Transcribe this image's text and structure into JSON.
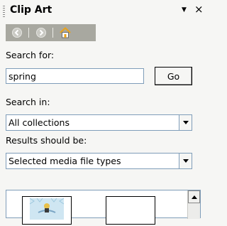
{
  "panel": {
    "title": "Clip Art"
  },
  "nav": {
    "icons": [
      "back-icon",
      "forward-icon",
      "home-icon"
    ],
    "colors": {
      "toolbar": "#a8a8a0",
      "arrow_circle": "#c9c9c3",
      "home_roof": "#e8a21c"
    }
  },
  "search": {
    "label": "Search for:",
    "value": "spring",
    "go_label": "Go"
  },
  "search_in": {
    "label": "Search in:",
    "selected": "All collections"
  },
  "results_type": {
    "label": "Results should be:",
    "selected": "Selected media file types"
  },
  "colors": {
    "field_border": "#7f9db9",
    "background": "#f6f6f4"
  }
}
